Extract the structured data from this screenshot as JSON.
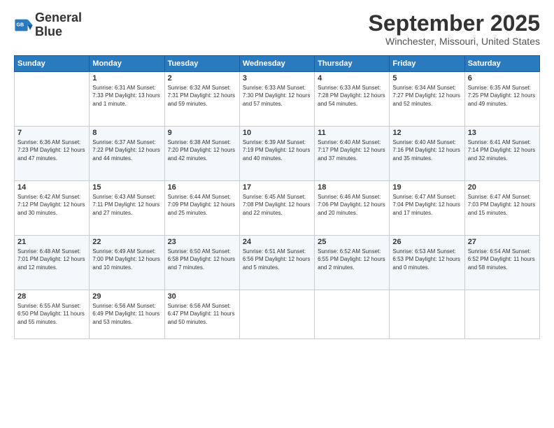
{
  "logo": {
    "line1": "General",
    "line2": "Blue"
  },
  "calendar": {
    "month": "September 2025",
    "location": "Winchester, Missouri, United States",
    "headers": [
      "Sunday",
      "Monday",
      "Tuesday",
      "Wednesday",
      "Thursday",
      "Friday",
      "Saturday"
    ],
    "rows": [
      [
        {
          "day": "",
          "info": ""
        },
        {
          "day": "1",
          "info": "Sunrise: 6:31 AM\nSunset: 7:33 PM\nDaylight: 13 hours\nand 1 minute."
        },
        {
          "day": "2",
          "info": "Sunrise: 6:32 AM\nSunset: 7:31 PM\nDaylight: 12 hours\nand 59 minutes."
        },
        {
          "day": "3",
          "info": "Sunrise: 6:33 AM\nSunset: 7:30 PM\nDaylight: 12 hours\nand 57 minutes."
        },
        {
          "day": "4",
          "info": "Sunrise: 6:33 AM\nSunset: 7:28 PM\nDaylight: 12 hours\nand 54 minutes."
        },
        {
          "day": "5",
          "info": "Sunrise: 6:34 AM\nSunset: 7:27 PM\nDaylight: 12 hours\nand 52 minutes."
        },
        {
          "day": "6",
          "info": "Sunrise: 6:35 AM\nSunset: 7:25 PM\nDaylight: 12 hours\nand 49 minutes."
        }
      ],
      [
        {
          "day": "7",
          "info": "Sunrise: 6:36 AM\nSunset: 7:23 PM\nDaylight: 12 hours\nand 47 minutes."
        },
        {
          "day": "8",
          "info": "Sunrise: 6:37 AM\nSunset: 7:22 PM\nDaylight: 12 hours\nand 44 minutes."
        },
        {
          "day": "9",
          "info": "Sunrise: 6:38 AM\nSunset: 7:20 PM\nDaylight: 12 hours\nand 42 minutes."
        },
        {
          "day": "10",
          "info": "Sunrise: 6:39 AM\nSunset: 7:19 PM\nDaylight: 12 hours\nand 40 minutes."
        },
        {
          "day": "11",
          "info": "Sunrise: 6:40 AM\nSunset: 7:17 PM\nDaylight: 12 hours\nand 37 minutes."
        },
        {
          "day": "12",
          "info": "Sunrise: 6:40 AM\nSunset: 7:16 PM\nDaylight: 12 hours\nand 35 minutes."
        },
        {
          "day": "13",
          "info": "Sunrise: 6:41 AM\nSunset: 7:14 PM\nDaylight: 12 hours\nand 32 minutes."
        }
      ],
      [
        {
          "day": "14",
          "info": "Sunrise: 6:42 AM\nSunset: 7:12 PM\nDaylight: 12 hours\nand 30 minutes."
        },
        {
          "day": "15",
          "info": "Sunrise: 6:43 AM\nSunset: 7:11 PM\nDaylight: 12 hours\nand 27 minutes."
        },
        {
          "day": "16",
          "info": "Sunrise: 6:44 AM\nSunset: 7:09 PM\nDaylight: 12 hours\nand 25 minutes."
        },
        {
          "day": "17",
          "info": "Sunrise: 6:45 AM\nSunset: 7:08 PM\nDaylight: 12 hours\nand 22 minutes."
        },
        {
          "day": "18",
          "info": "Sunrise: 6:46 AM\nSunset: 7:06 PM\nDaylight: 12 hours\nand 20 minutes."
        },
        {
          "day": "19",
          "info": "Sunrise: 6:47 AM\nSunset: 7:04 PM\nDaylight: 12 hours\nand 17 minutes."
        },
        {
          "day": "20",
          "info": "Sunrise: 6:47 AM\nSunset: 7:03 PM\nDaylight: 12 hours\nand 15 minutes."
        }
      ],
      [
        {
          "day": "21",
          "info": "Sunrise: 6:48 AM\nSunset: 7:01 PM\nDaylight: 12 hours\nand 12 minutes."
        },
        {
          "day": "22",
          "info": "Sunrise: 6:49 AM\nSunset: 7:00 PM\nDaylight: 12 hours\nand 10 minutes."
        },
        {
          "day": "23",
          "info": "Sunrise: 6:50 AM\nSunset: 6:58 PM\nDaylight: 12 hours\nand 7 minutes."
        },
        {
          "day": "24",
          "info": "Sunrise: 6:51 AM\nSunset: 6:56 PM\nDaylight: 12 hours\nand 5 minutes."
        },
        {
          "day": "25",
          "info": "Sunrise: 6:52 AM\nSunset: 6:55 PM\nDaylight: 12 hours\nand 2 minutes."
        },
        {
          "day": "26",
          "info": "Sunrise: 6:53 AM\nSunset: 6:53 PM\nDaylight: 12 hours\nand 0 minutes."
        },
        {
          "day": "27",
          "info": "Sunrise: 6:54 AM\nSunset: 6:52 PM\nDaylight: 11 hours\nand 58 minutes."
        }
      ],
      [
        {
          "day": "28",
          "info": "Sunrise: 6:55 AM\nSunset: 6:50 PM\nDaylight: 11 hours\nand 55 minutes."
        },
        {
          "day": "29",
          "info": "Sunrise: 6:56 AM\nSunset: 6:49 PM\nDaylight: 11 hours\nand 53 minutes."
        },
        {
          "day": "30",
          "info": "Sunrise: 6:56 AM\nSunset: 6:47 PM\nDaylight: 11 hours\nand 50 minutes."
        },
        {
          "day": "",
          "info": ""
        },
        {
          "day": "",
          "info": ""
        },
        {
          "day": "",
          "info": ""
        },
        {
          "day": "",
          "info": ""
        }
      ]
    ]
  }
}
